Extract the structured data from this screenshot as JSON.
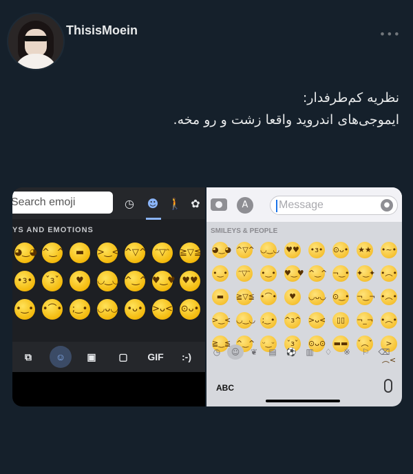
{
  "user": {
    "username": "ThisisMoein",
    "more_label": "•••"
  },
  "tweet": {
    "line1": "نظریه کم‌طرفدار:",
    "line2": "ایموجی‌های اندروید واقعا زشت و رو مخه."
  },
  "android_keyboard": {
    "search_placeholder": "Search emoji",
    "category_label": "YS AND EMOTIONS",
    "bottom_gif_label": "GIF",
    "bottom_emoticon_label": ":-)"
  },
  "ios_keyboard": {
    "message_placeholder": "Message",
    "category_label": "SMILEYS & PEOPLE",
    "abc_label": "ABC"
  }
}
